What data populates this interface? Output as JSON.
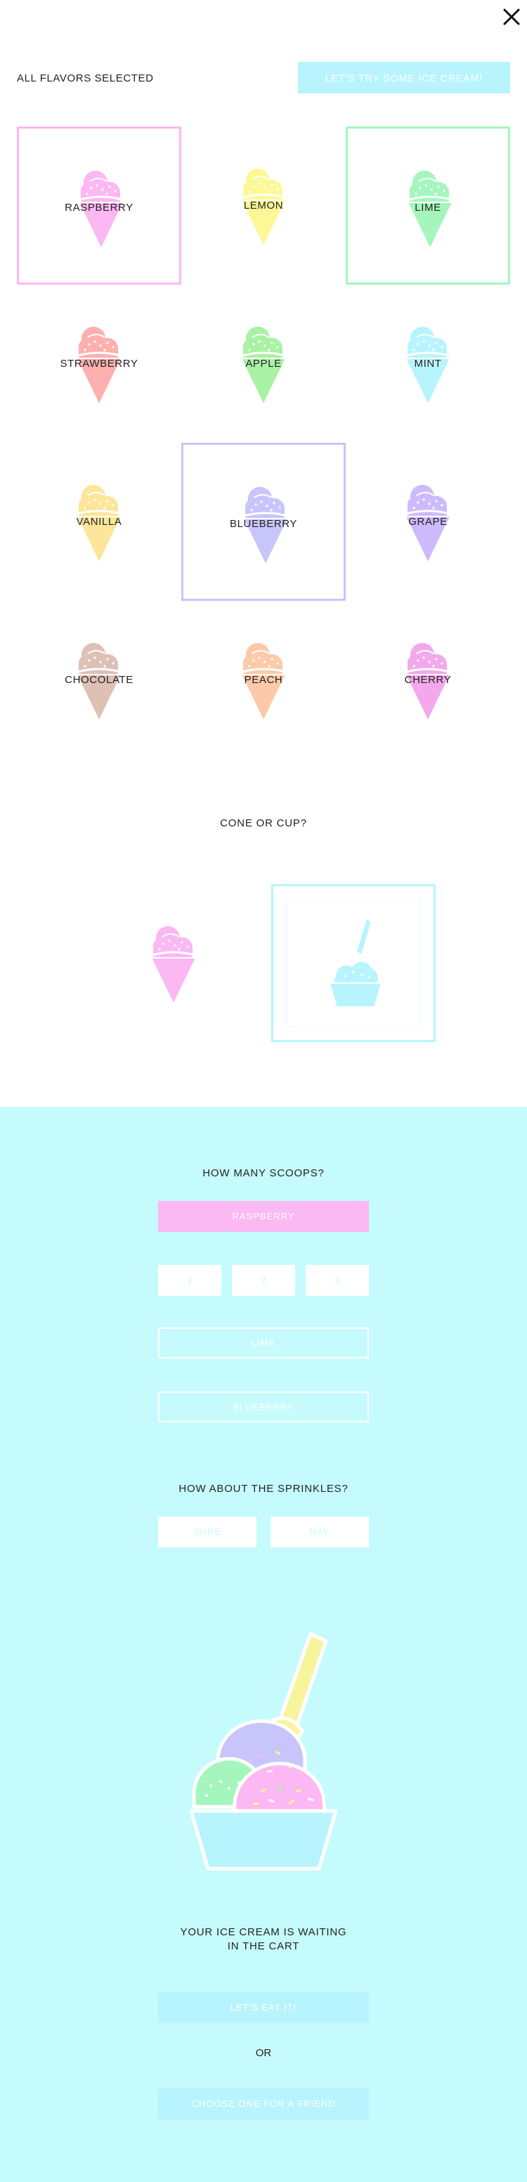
{
  "header": {
    "close_icon": "close-icon",
    "status_label": "ALL FLAVORS SELECTED",
    "try_button": "LET'S TRY SOME ICE CREAM!"
  },
  "flavors": [
    {
      "name": "RASPBERRY",
      "color": "#fbb8f2",
      "selected": true
    },
    {
      "name": "LEMON",
      "color": "#fdf896",
      "selected": false
    },
    {
      "name": "LIME",
      "color": "#a5f6bd",
      "selected": true
    },
    {
      "name": "STRAWBERRY",
      "color": "#fdb0ad",
      "selected": false
    },
    {
      "name": "APPLE",
      "color": "#a9f2a4",
      "selected": false
    },
    {
      "name": "MINT",
      "color": "#b8f4fd",
      "selected": false
    },
    {
      "name": "VANILLA",
      "color": "#fde59a",
      "selected": false
    },
    {
      "name": "BLUEBERRY",
      "color": "#c8c5fb",
      "selected": true
    },
    {
      "name": "GRAPE",
      "color": "#cdbafb",
      "selected": false
    },
    {
      "name": "CHOCOLATE",
      "color": "#dfc0b5",
      "selected": false
    },
    {
      "name": "PEACH",
      "color": "#fdcaa9",
      "selected": false
    },
    {
      "name": "CHERRY",
      "color": "#f3a8ec",
      "selected": false
    }
  ],
  "container": {
    "question": "CONE OR CUP?",
    "cone_color": "#fbb8f2",
    "cup_color": "#b8f4fd",
    "selected": "cup"
  },
  "scoops": {
    "question": "HOW MANY SCOOPS?",
    "flavor_buttons": [
      "RASPBERRY",
      "LIME",
      "BLUEBERRY"
    ],
    "counts": [
      "1",
      "2",
      "3"
    ]
  },
  "sprinkles": {
    "question": "HOW ABOUT THE SPRINKLES?",
    "yes": "SURE",
    "no": "NAY"
  },
  "cart": {
    "message_line1": "YOUR ICE CREAM IS WAITING",
    "message_line2": "IN THE CART",
    "eat_button": "LET'S EAT IT!",
    "or": "OR",
    "friend_button": "CHOOSE ONE FOR A FRIEND"
  },
  "colors": {
    "accent": "#b8f4fd",
    "bottom_bg": "#c6fbfd",
    "raspberry": "#fbb8f2",
    "lime": "#a5f6bd",
    "blueberry": "#c8c5fb",
    "spoon": "#f7f59b"
  }
}
